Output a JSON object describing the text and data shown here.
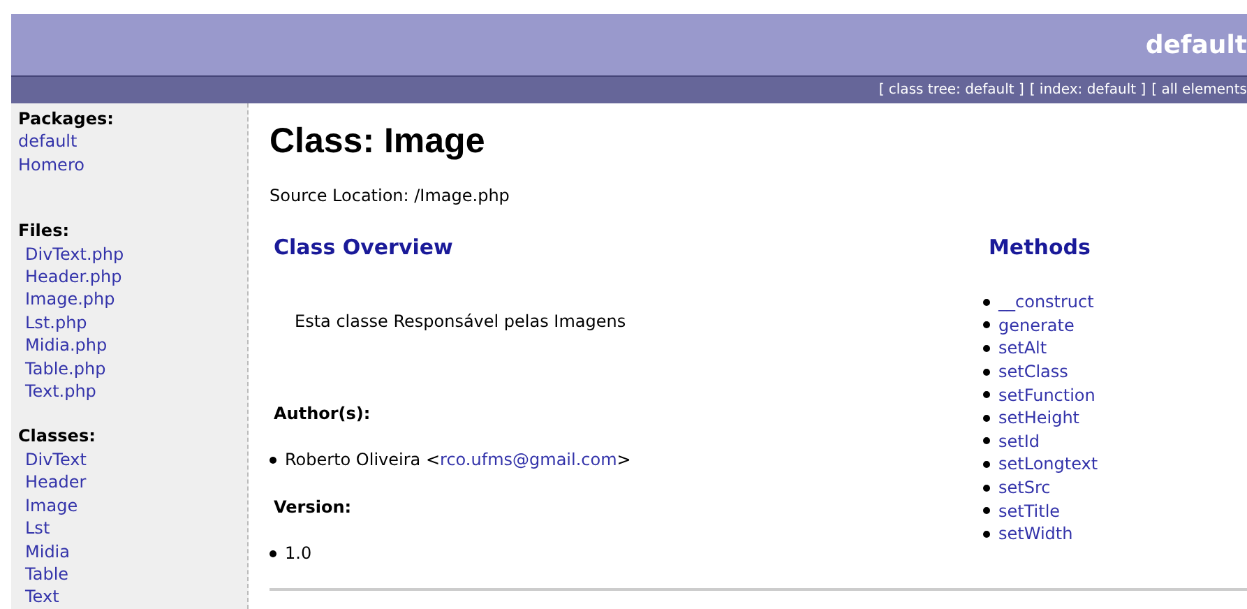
{
  "header": {
    "title": "default",
    "nav": [
      "[ class tree: default ]",
      "[ index: default ]",
      "[ all elements"
    ]
  },
  "sidebar": {
    "sections": [
      {
        "heading": "Packages:",
        "kind": "packages",
        "items": [
          "default",
          "Homero"
        ]
      },
      {
        "heading": "Files:",
        "kind": "files",
        "items": [
          "DivText.php",
          "Header.php",
          "Image.php",
          "Lst.php",
          "Midia.php",
          "Table.php",
          "Text.php"
        ]
      },
      {
        "heading": "Classes:",
        "kind": "files",
        "items": [
          "DivText",
          "Header",
          "Image",
          "Lst",
          "Midia",
          "Table",
          "Text"
        ]
      }
    ]
  },
  "main": {
    "title": "Class: Image",
    "source": "Source Location: /Image.php",
    "overview_heading": "Class Overview",
    "description": "Esta classe Responsável pelas Imagens",
    "author_heading": "Author(s):",
    "author": {
      "prefix": "Roberto Oliveira <",
      "email": "rco.ufms@gmail.com",
      "suffix": ">"
    },
    "version_heading": "Version:",
    "version": "1.0",
    "methods_heading": "Methods",
    "methods": [
      "__construct",
      "generate",
      "setAlt",
      "setClass",
      "setFunction",
      "setHeight",
      "setId",
      "setLongtext",
      "setSrc",
      "setTitle",
      "setWidth"
    ]
  }
}
